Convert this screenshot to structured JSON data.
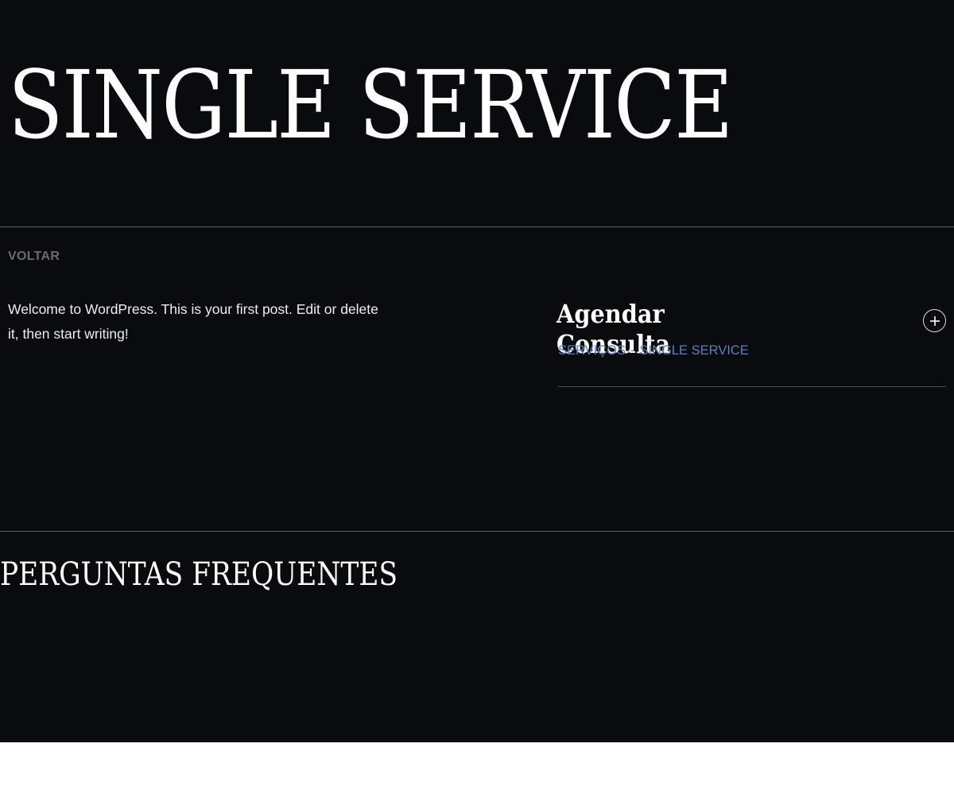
{
  "hero": {
    "title": "SINGLE SERVICE"
  },
  "navigation": {
    "back_label": "VOLTAR"
  },
  "post": {
    "body": "Welcome to WordPress. This is your first post. Edit or delete it, then start writing!"
  },
  "sidebar": {
    "accordion_title": "Agendar Consulta",
    "toggle_icon": "plus-icon",
    "breadcrumb": [
      "SERVIÇOS",
      "SINGLE SERVICE"
    ],
    "breadcrumb_separator": "-"
  },
  "faq": {
    "title": "PERGUNTAS FREQUENTES"
  },
  "colors": {
    "background": "#0a0b0e",
    "text": "#ffffff",
    "muted": "#6a6c72",
    "link": "#5b7fc4",
    "divider": "#5e6066"
  }
}
